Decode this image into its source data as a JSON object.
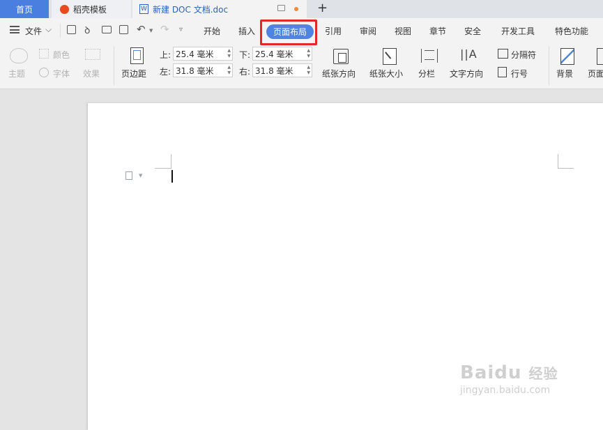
{
  "tabs": {
    "home": "首页",
    "template": "稻壳模板",
    "document": "新建 DOC 文档.doc",
    "add": "+"
  },
  "menu": {
    "file": "文件",
    "items": [
      "开始",
      "插入",
      "页面布局",
      "引用",
      "审阅",
      "视图",
      "章节",
      "安全",
      "开发工具",
      "特色功能"
    ],
    "active": "页面布局"
  },
  "theme": {
    "theme": "主题",
    "color": "颜色",
    "font": "字体",
    "effect": "效果"
  },
  "margins": {
    "label": "页边距",
    "top_label": "上:",
    "top": "25.4 毫米",
    "bottom_label": "下:",
    "bottom": "25.4 毫米",
    "left_label": "左:",
    "left": "31.8 毫米",
    "right_label": "右:",
    "right": "31.8 毫米"
  },
  "tools": {
    "orientation": "纸张方向",
    "size": "纸张大小",
    "columns": "分栏",
    "text_dir": "文字方向",
    "breaks": "分隔符",
    "line_num": "行号",
    "background": "背景",
    "page_border": "页面"
  },
  "watermark": {
    "brand": "Baidu",
    "brand_cn": "经验",
    "url": "jingyan.baidu.com"
  },
  "colors": {
    "accent": "#4f84e3",
    "highlight": "#e3262a"
  }
}
